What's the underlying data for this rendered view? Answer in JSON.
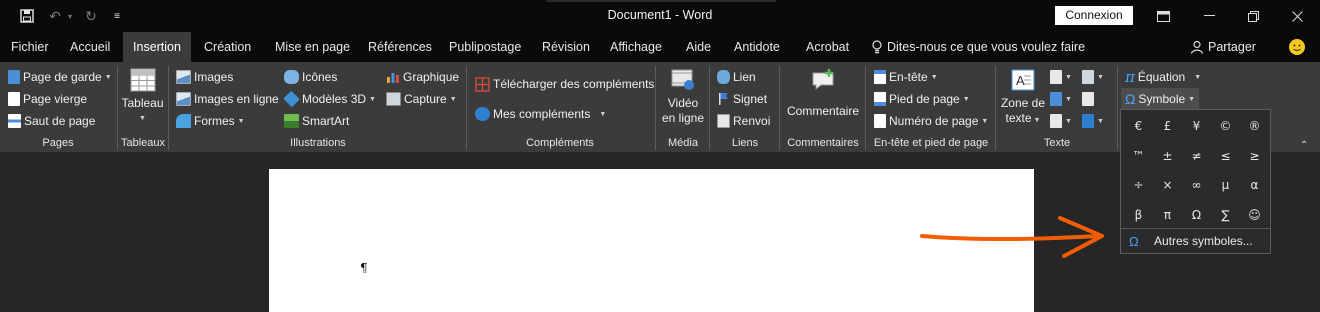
{
  "window": {
    "title": "Document1  -  Word",
    "signin": "Connexion",
    "undo_icon": "undo-icon",
    "redo_icon": "redo-icon"
  },
  "tabs": [
    "Fichier",
    "Accueil",
    "Insertion",
    "Création",
    "Mise en page",
    "Références",
    "Publipostage",
    "Révision",
    "Affichage",
    "Aide",
    "Antidote",
    "Acrobat"
  ],
  "active_tab": "Insertion",
  "tellme": "Dites-nous ce que vous voulez faire",
  "share": "Partager",
  "groups": {
    "pages": {
      "label": "Pages",
      "items": [
        "Page de garde",
        "Page vierge",
        "Saut de page"
      ]
    },
    "tableaux": {
      "label": "Tableaux",
      "button": "Tableau"
    },
    "illustrations": {
      "label": "Illustrations",
      "col1": [
        "Images",
        "Images en ligne",
        "Formes"
      ],
      "col2": [
        "Icônes",
        "Modèles 3D",
        "SmartArt"
      ],
      "col3": [
        "Graphique",
        "Capture"
      ]
    },
    "complements": {
      "label": "Compléments",
      "items": [
        "Télécharger des compléments",
        "Mes compléments"
      ]
    },
    "media": {
      "label": "Média",
      "button_line1": "Vidéo",
      "button_line2": "en ligne"
    },
    "liens": {
      "label": "Liens",
      "items": [
        "Lien",
        "Signet",
        "Renvoi"
      ]
    },
    "commentaires": {
      "label": "Commentaires",
      "button": "Commentaire"
    },
    "entete": {
      "label": "En-tête et pied de page",
      "items": [
        "En-tête",
        "Pied de page",
        "Numéro de page"
      ]
    },
    "texte": {
      "label": "Texte",
      "button_line1": "Zone de",
      "button_line2": "texte"
    },
    "symboles": {
      "items": [
        "Équation",
        "Symbole"
      ]
    }
  },
  "symbols": [
    "€",
    "£",
    "¥",
    "©",
    "®",
    "™",
    "±",
    "≠",
    "≤",
    "≥",
    "÷",
    "×",
    "∞",
    "µ",
    "α",
    "β",
    "π",
    "Ω",
    "∑",
    "☺"
  ],
  "more_symbols": "Autres symboles...",
  "document": {
    "pilcrow": "¶"
  },
  "colors": {
    "accent_arrow": "#f25c05",
    "ribbon": "#3b3b3b",
    "titlebar": "#0a0a0a"
  }
}
